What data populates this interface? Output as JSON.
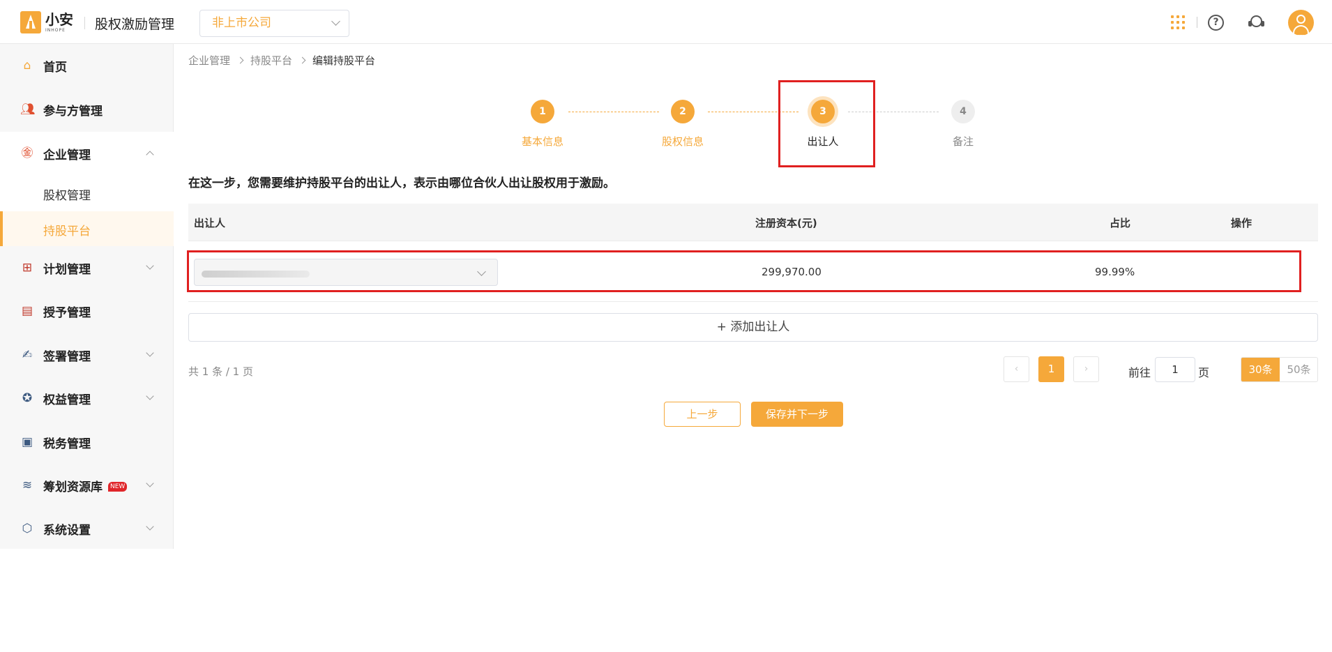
{
  "header": {
    "logo_cn": "小安",
    "logo_en": "INHOPE",
    "app_title": "股权激励管理",
    "company_select": "非上市公司"
  },
  "sidebar": {
    "home": "首页",
    "participants": "参与方管理",
    "enterprise": "企业管理",
    "enterprise_children": [
      "股权管理",
      "持股平台"
    ],
    "plan": "计划管理",
    "grant": "授予管理",
    "sign": "签署管理",
    "rights": "权益管理",
    "tax": "税务管理",
    "resources": "筹划资源库",
    "resources_badge": "NEW",
    "settings": "系统设置"
  },
  "breadcrumb": [
    "企业管理",
    "持股平台",
    "编辑持股平台"
  ],
  "steps": [
    {
      "num": "1",
      "label": "基本信息"
    },
    {
      "num": "2",
      "label": "股权信息"
    },
    {
      "num": "3",
      "label": "出让人"
    },
    {
      "num": "4",
      "label": "备注"
    }
  ],
  "intro": "在这一步，您需要维护持股平台的出让人，表示由哪位合伙人出让股权用于激励。",
  "table": {
    "headers": [
      "出让人",
      "注册资本(元)",
      "占比",
      "操作"
    ],
    "rows": [
      {
        "capital": "299,970.00",
        "ratio": "99.99%"
      }
    ]
  },
  "add_button": "+ 添加出让人",
  "pagination": {
    "total": "共 1 条 / 1 页",
    "current": "1",
    "goto_prefix": "前往",
    "goto_value": "1",
    "goto_suffix": "页",
    "sizes": [
      "30条",
      "50条"
    ]
  },
  "actions": {
    "prev": "上一步",
    "next": "保存并下一步"
  }
}
